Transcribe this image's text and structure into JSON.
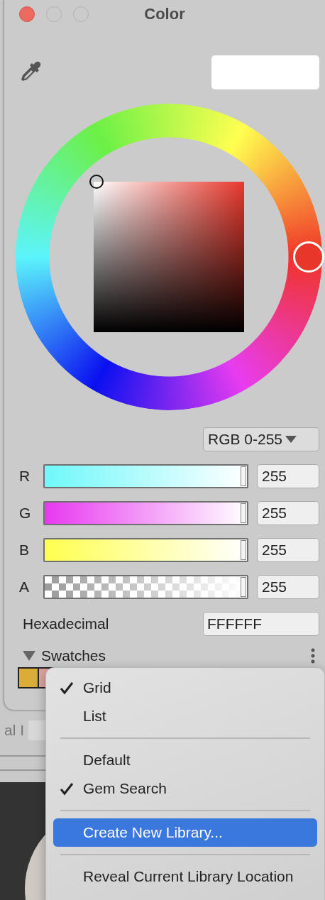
{
  "window": {
    "title": "Color"
  },
  "mode_dropdown": {
    "value": "RGB 0-255"
  },
  "channels": [
    {
      "label": "R",
      "kind": "color",
      "color": "#6ff8fa",
      "level": 1,
      "value": "255"
    },
    {
      "label": "G",
      "kind": "color",
      "color": "#e838f0",
      "level": 1,
      "value": "255"
    },
    {
      "label": "B",
      "kind": "color",
      "color": "#ffff50",
      "level": 1,
      "value": "255"
    },
    {
      "label": "A",
      "kind": "alpha",
      "level": 1,
      "value": "255"
    }
  ],
  "hex": {
    "label": "Hexadecimal",
    "value": "FFFFFF"
  },
  "swatches": {
    "title": "Swatches",
    "expanded": true,
    "items": [
      {
        "color": "#d8ae38"
      },
      {
        "color": "#e0a2a2"
      }
    ]
  },
  "background": {
    "label": "al I"
  },
  "menu": {
    "groups": [
      {
        "items": [
          {
            "label": "Grid",
            "checked": true,
            "selected": false
          },
          {
            "label": "List",
            "checked": false,
            "selected": false
          }
        ]
      },
      {
        "items": [
          {
            "label": "Default",
            "checked": false,
            "selected": false
          },
          {
            "label": "Gem Search",
            "checked": true,
            "selected": false
          }
        ]
      },
      {
        "items": [
          {
            "label": "Create New Library...",
            "checked": false,
            "selected": true
          }
        ]
      },
      {
        "items": [
          {
            "label": "Reveal Current Library Location",
            "checked": false,
            "selected": false
          }
        ]
      }
    ]
  }
}
